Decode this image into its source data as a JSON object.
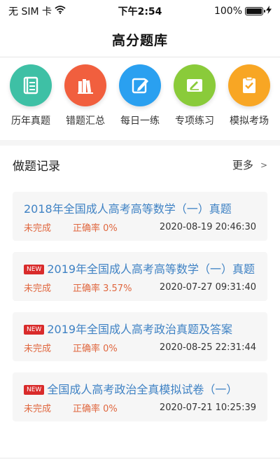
{
  "status_bar": {
    "carrier": "无 SIM 卡",
    "time": "下午2:54",
    "battery_text": "100%",
    "battery_level": 1.0
  },
  "nav": {
    "title": "高分题库"
  },
  "categories": [
    {
      "label": "历年真题",
      "icon": "ledger-icon",
      "color": "#3ec0a5"
    },
    {
      "label": "错题汇总",
      "icon": "books-icon",
      "color": "#f15f3e"
    },
    {
      "label": "每日一练",
      "icon": "pencil-edit-icon",
      "color": "#2aa0f0"
    },
    {
      "label": "专项练习",
      "icon": "notebook-pen-icon",
      "color": "#8acb3a"
    },
    {
      "label": "模拟考场",
      "icon": "clipboard-check-icon",
      "color": "#f8a624"
    }
  ],
  "records": {
    "title": "做题记录",
    "more_label": "更多",
    "more_chevron": ">",
    "items": [
      {
        "badge": "",
        "name": "2018年全国成人高考高等数学（一）真题",
        "status": "未完成",
        "accuracy": "正确率 0%",
        "time": "2020-08-19 20:46:30"
      },
      {
        "badge": "NEW",
        "name": "2019年全国成人高考高等数学（一）真题",
        "status": "未完成",
        "accuracy": "正确率 3.57%",
        "time": "2020-07-27 09:31:40"
      },
      {
        "badge": "NEW",
        "name": "2019年全国成人高考政治真题及答案",
        "status": "未完成",
        "accuracy": "正确率 0%",
        "time": "2020-08-25 22:31:44"
      },
      {
        "badge": "NEW",
        "name": "全国成人高考政治全真模拟试卷（一）",
        "status": "未完成",
        "accuracy": "正确率 0%",
        "time": "2020-07-21 10:25:39"
      }
    ]
  }
}
